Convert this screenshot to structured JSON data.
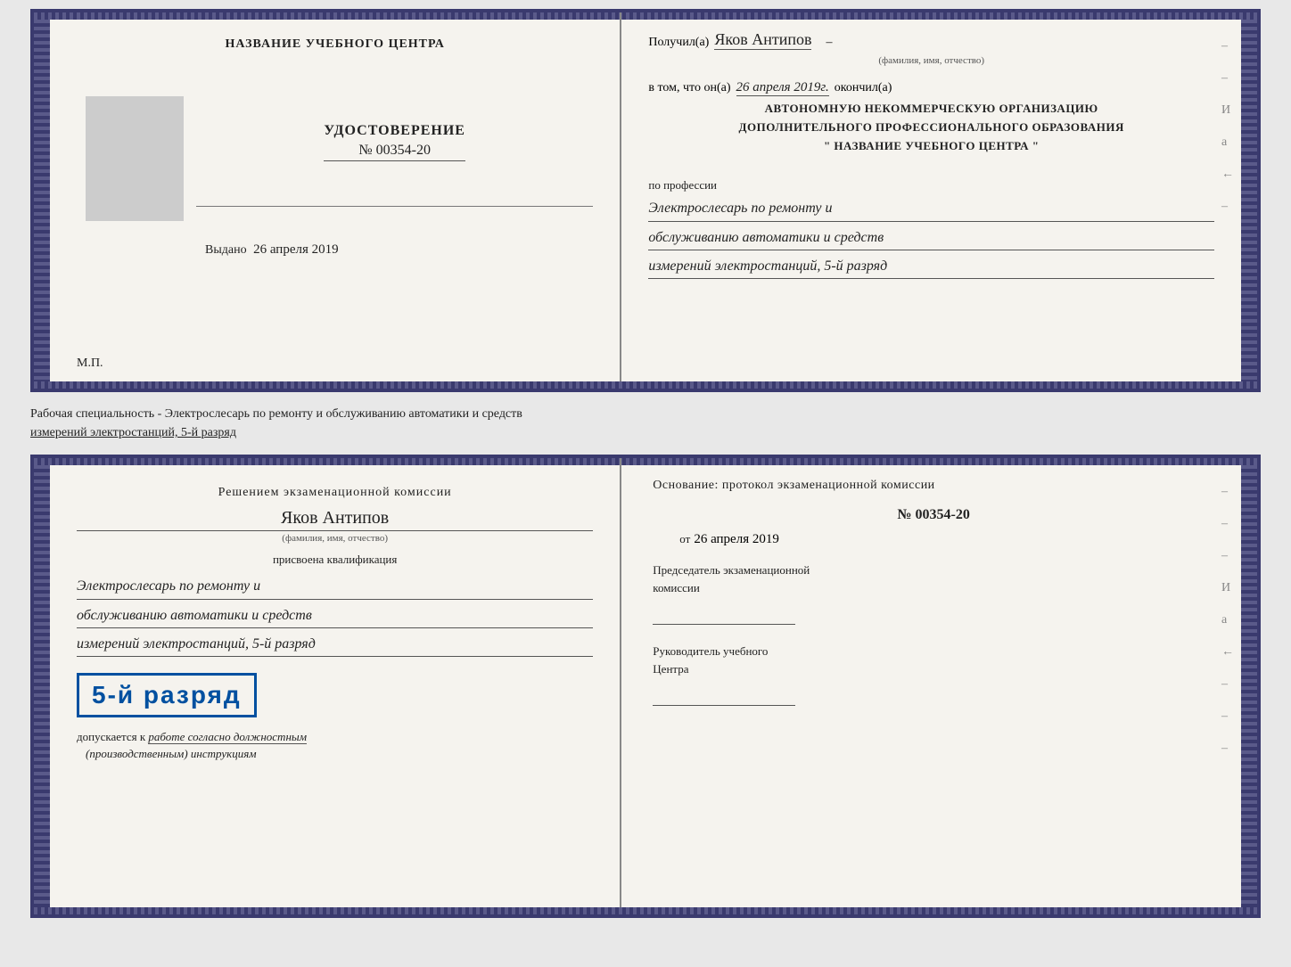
{
  "topDoc": {
    "leftPanel": {
      "centerTitle": "НАЗВАНИЕ УЧЕБНОГО ЦЕНТРА",
      "photoAlt": "photo placeholder",
      "certTitle": "УДОСТОВЕРЕНИЕ",
      "certNumber": "№ 00354-20",
      "issuedLabel": "Выдано",
      "issuedDate": "26 апреля 2019",
      "mpLabel": "М.П."
    },
    "rightPanel": {
      "receivedLabel": "Получил(а)",
      "recipientName": "Яков Антипов",
      "recipientSubLabel": "(фамилия, имя, отчество)",
      "dashMark": "–",
      "factLabel": "в том, что он(а)",
      "factDate": "26 апреля 2019г.",
      "completedLabel": "окончил(а)",
      "orgLine1": "АВТОНОМНУЮ НЕКОММЕРЧЕСКУЮ ОРГАНИЗАЦИЮ",
      "orgLine2": "ДОПОЛНИТЕЛЬНОГО ПРОФЕССИОНАЛЬНОГО ОБРАЗОВАНИЯ",
      "orgLine3": "\"  НАЗВАНИЕ УЧЕБНОГО ЦЕНТРА  \"",
      "professionLabel": "по профессии",
      "professionLine1": "Электрослесарь по ремонту и",
      "professionLine2": "обслуживанию автоматики и средств",
      "professionLine3": "измерений электростанций, 5-й разряд"
    }
  },
  "separatorText": {
    "line1": "Рабочая специальность - Электрослесарь по ремонту и обслуживанию автоматики и средств",
    "line2": "измерений электростанций, 5-й разряд"
  },
  "bottomDoc": {
    "leftPanel": {
      "decisionLine1": "Решением  экзаменационной  комиссии",
      "nameHandwritten": "Яков Антипов",
      "nameSubLabel": "(фамилия, имя, отчество)",
      "assignedLabel": "присвоена квалификация",
      "qualLine1": "Электрослесарь по ремонту и",
      "qualLine2": "обслуживанию автоматики и средств",
      "qualLine3": "измерений электростанций, 5-й разряд",
      "gradeBadge": "5-й разряд",
      "allowLabel": "допускается к",
      "allowText": "работе согласно должностным",
      "allowText2": "(производственным) инструкциям"
    },
    "rightPanel": {
      "basisLabel": "Основание: протокол экзаменационной  комиссии",
      "protocolNumber": "№  00354-20",
      "fromLabel": "от",
      "fromDate": "26 апреля 2019",
      "chairmanTitle": "Председатель экзаменационной",
      "chairmanSubTitle": "комиссии",
      "headTitle": "Руководитель учебного",
      "headSubTitle": "Центра"
    }
  },
  "marks": {
    "dash": "–",
    "и": "И",
    "а": "а",
    "arrow": "←"
  }
}
